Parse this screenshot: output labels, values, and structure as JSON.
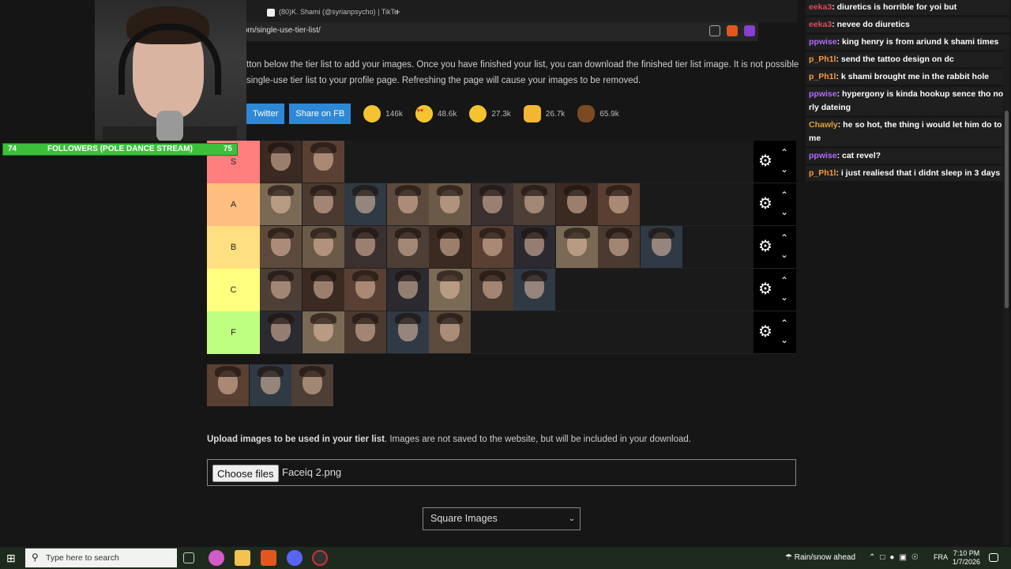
{
  "browser": {
    "tabs": [
      {
        "label": "(80)K. Shami (@syrianpsycho) | TikTo"
      }
    ],
    "new_tab": "+",
    "url": "om/single-use-tier-list/"
  },
  "intro": {
    "line1": "tton below the tier list to add your images. Once you have finished your list, you can download the finished tier list image. It is not possible",
    "line2": "single-use tier list to your profile page. Refreshing the page will cause your images to be removed."
  },
  "share": {
    "twitter": "Twitter",
    "facebook": "Share on FB",
    "reactions": [
      {
        "icon": "smile-emoji-icon",
        "count": "146k"
      },
      {
        "icon": "heart-eyes-emoji-icon",
        "count": "48.6k"
      },
      {
        "icon": "laugh-emoji-icon",
        "count": "27.3k"
      },
      {
        "icon": "raised-hands-emoji-icon",
        "count": "26.7k"
      },
      {
        "icon": "poop-emoji-icon",
        "count": "65.9k"
      }
    ]
  },
  "tiers": [
    {
      "label": "S",
      "color": "#ff7f7f",
      "count": 2
    },
    {
      "label": "A",
      "color": "#ffbf7f",
      "count": 9
    },
    {
      "label": "B",
      "color": "#ffdf7f",
      "count": 10
    },
    {
      "label": "C",
      "color": "#ffff7f",
      "count": 7
    },
    {
      "label": "F",
      "color": "#bfff7f",
      "count": 5
    }
  ],
  "pool_count": 3,
  "upload": {
    "bold": "Upload images to be used in your tier list",
    "rest": ". Images are not saved to the website, but will be included in your download.",
    "choose": "Choose files",
    "filename": "Faceiq 2.png"
  },
  "select": {
    "value": "Square Images"
  },
  "overlay": {
    "follow_left": "74",
    "follow_label": "FOLLOWERS (POLE DANCE STREAM)",
    "follow_right": "75"
  },
  "chat": [
    {
      "user": "eeka3",
      "color": "#e0495a",
      "text": ": diuretics is horrible for yoi but"
    },
    {
      "user": "eeka3",
      "color": "#e0495a",
      "text": ": nevee do diuretics"
    },
    {
      "user": "ppwise",
      "color": "#b36bff",
      "text": ": king henry is from ariund k shami times"
    },
    {
      "user": "p_Ph1l",
      "color": "#ff9a3c",
      "text": ": send the tattoo design on dc"
    },
    {
      "user": "p_Ph1l",
      "color": "#ff9a3c",
      "text": ": k shami brought me in the rabbit hole"
    },
    {
      "user": "ppwise",
      "color": "#b36bff",
      "text": ": hypergony is kinda hookup sence tho not rly dateing"
    },
    {
      "user": "Chawly",
      "color": "#e0a23c",
      "text": ": he so hot, the thing i would let him do to me"
    },
    {
      "user": "ppwise",
      "color": "#b36bff",
      "text": ": cat revel?"
    },
    {
      "user": "p_Ph1l",
      "color": "#ff9a3c",
      "text": ": i just realiesd that i didnt sleep in 3 days"
    }
  ],
  "taskbar": {
    "search_placeholder": "Type here to search",
    "weather": "Rain/snow ahead",
    "lang": "FRA",
    "time": "7:10 PM",
    "date": "1/7/2026"
  }
}
